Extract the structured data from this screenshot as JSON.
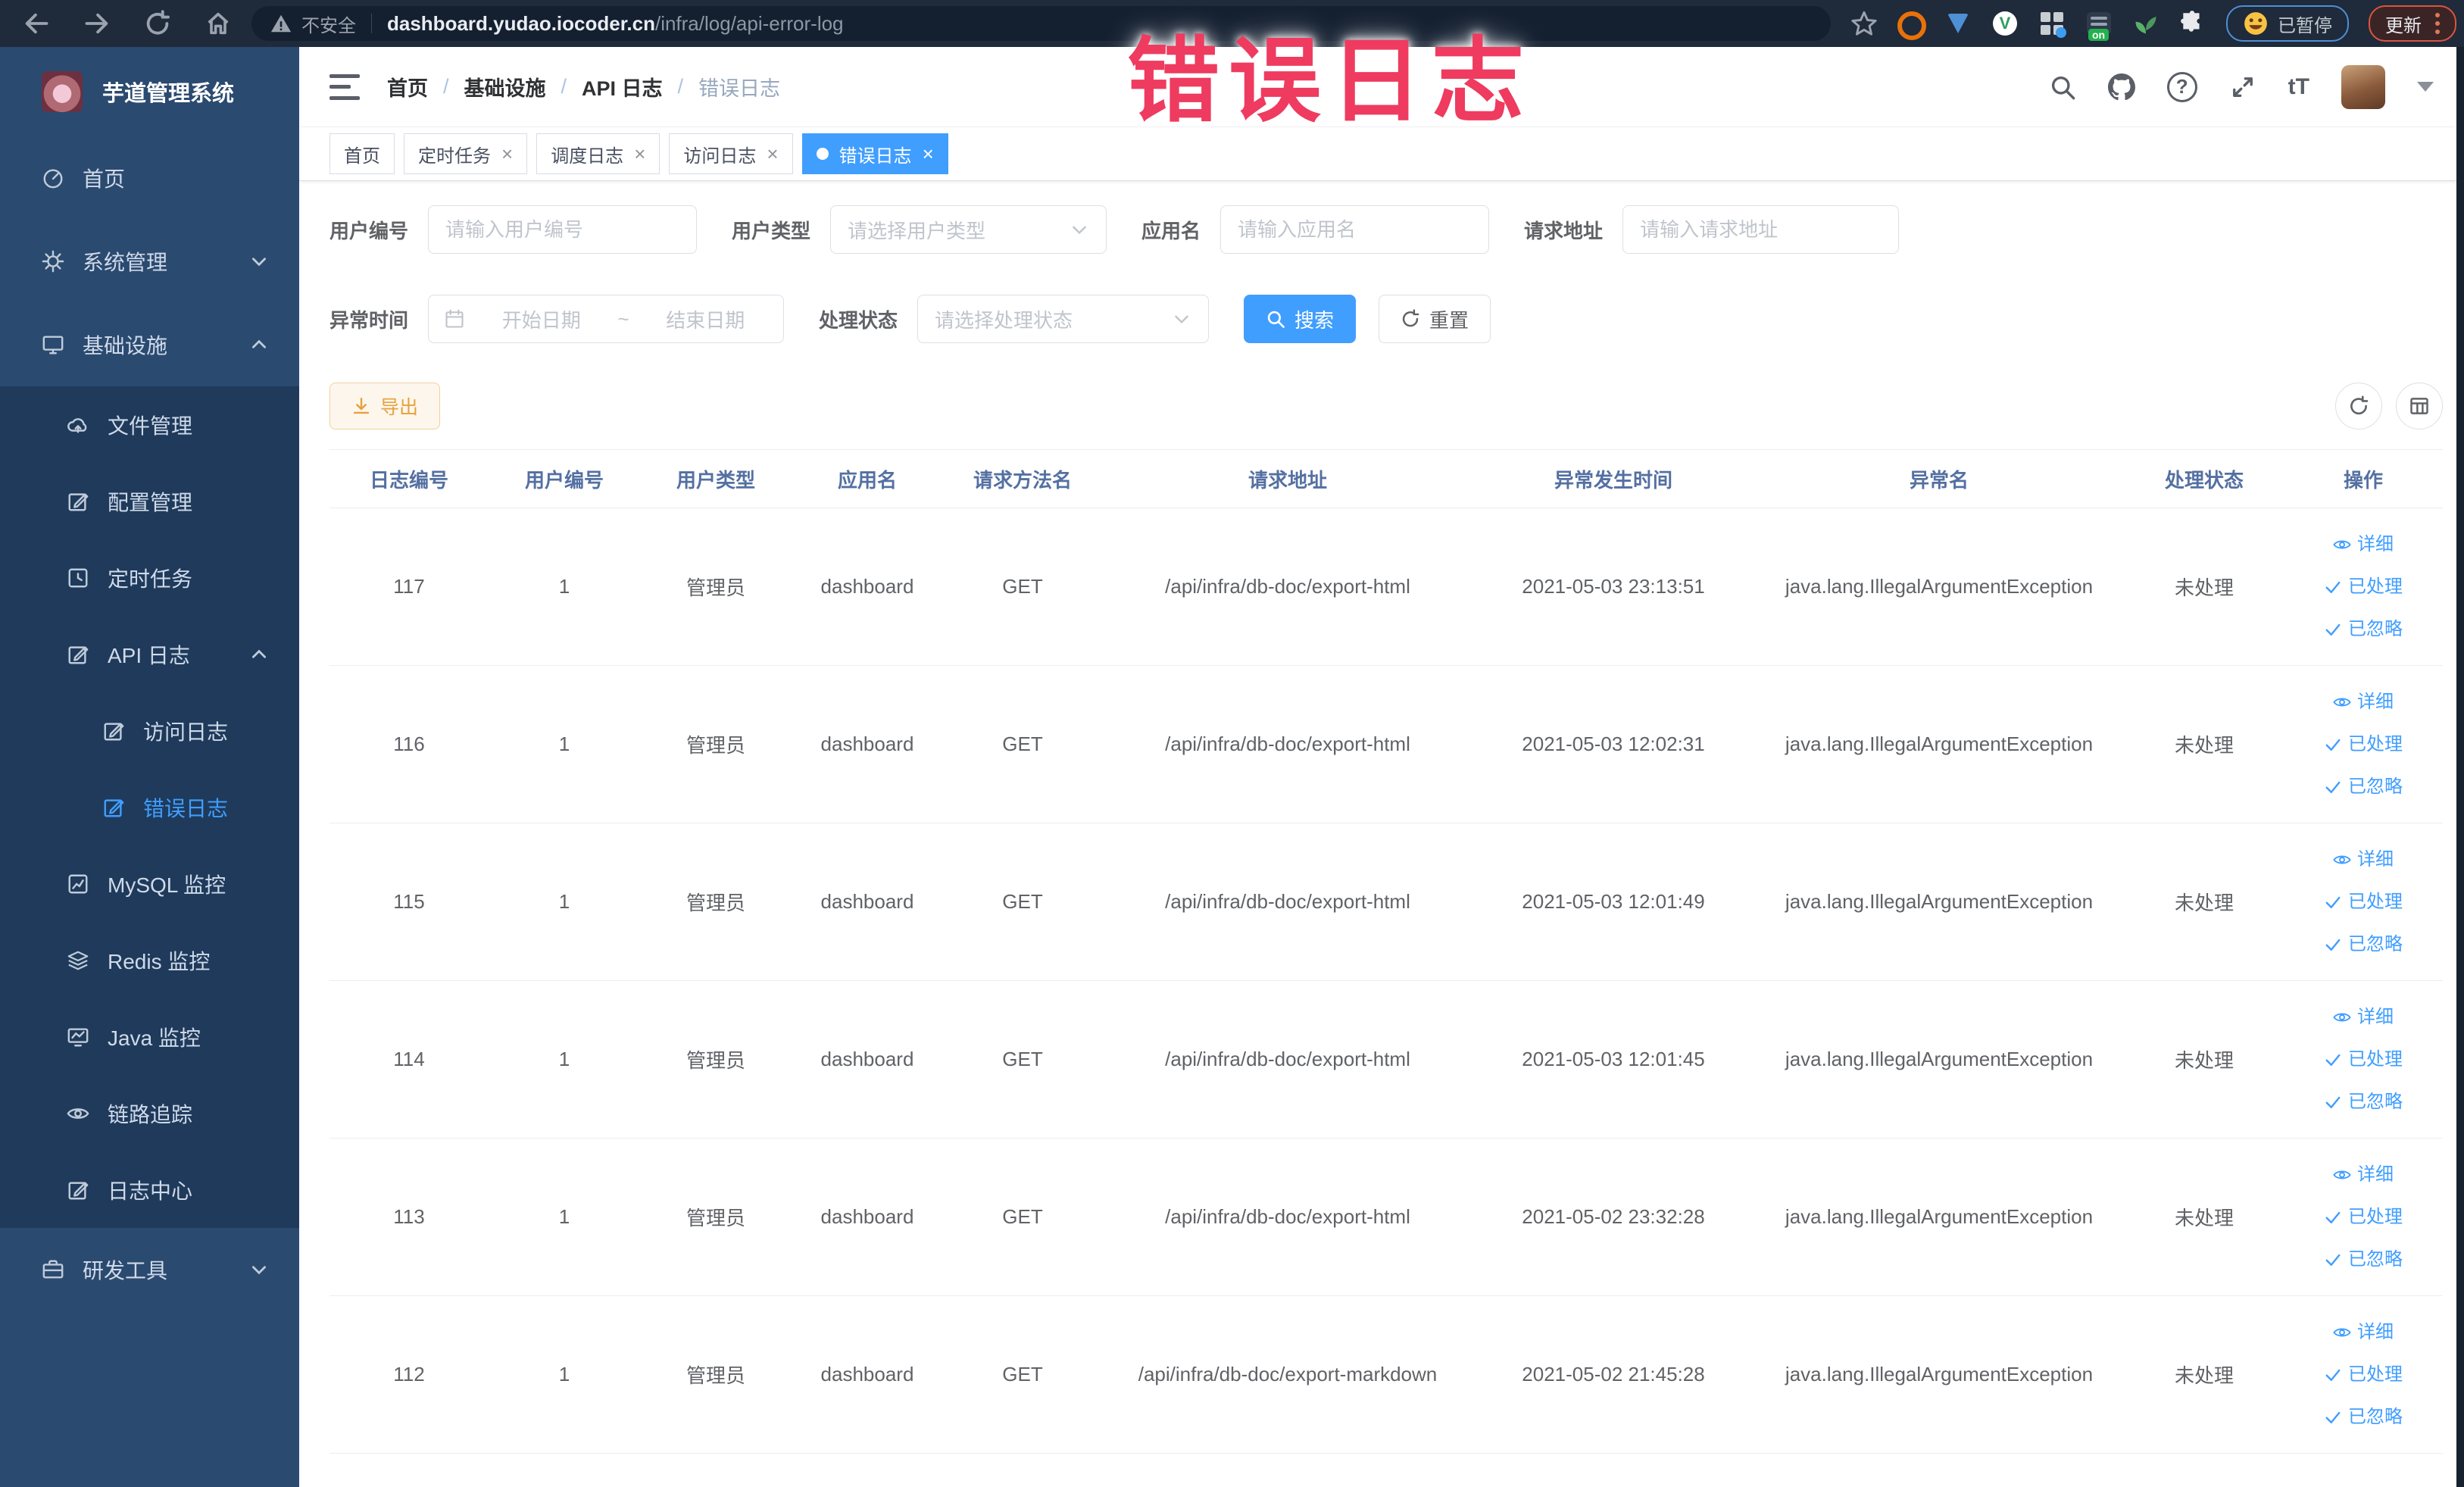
{
  "browser": {
    "security_label": "不安全",
    "url_domain": "dashboard.yudao.iocoder.cn",
    "url_path": "/infra/log/api-error-log",
    "paused_label": "已暂停",
    "update_label": "更新"
  },
  "annotation": {
    "text": "错误日志",
    "color": "#ee3b5f"
  },
  "app": {
    "logo_title": "芋道管理系统"
  },
  "sidebar": {
    "home": "首页",
    "system": "系统管理",
    "infra": "基础设施",
    "file": "文件管理",
    "config": "配置管理",
    "job": "定时任务",
    "api_log": "API 日志",
    "access_log": "访问日志",
    "error_log": "错误日志",
    "mysql": "MySQL 监控",
    "redis": "Redis 监控",
    "java": "Java 监控",
    "tracer": "链路追踪",
    "log_center": "日志中心",
    "dev_tools": "研发工具"
  },
  "breadcrumb": {
    "items": [
      "首页",
      "基础设施",
      "API 日志",
      "错误日志"
    ],
    "separator": "/"
  },
  "tabs": [
    {
      "label": "首页"
    },
    {
      "label": "定时任务"
    },
    {
      "label": "调度日志"
    },
    {
      "label": "访问日志"
    },
    {
      "label": "错误日志"
    }
  ],
  "filters": {
    "user_id_label": "用户编号",
    "user_id_placeholder": "请输入用户编号",
    "user_type_label": "用户类型",
    "user_type_placeholder": "请选择用户类型",
    "app_name_label": "应用名",
    "app_name_placeholder": "请输入应用名",
    "req_url_label": "请求地址",
    "req_url_placeholder": "请输入请求地址",
    "time_label": "异常时间",
    "time_start_placeholder": "开始日期",
    "time_separator": "~",
    "time_end_placeholder": "结束日期",
    "status_label": "处理状态",
    "status_placeholder": "请选择处理状态",
    "search_label": "搜索",
    "reset_label": "重置"
  },
  "actions": {
    "export_label": "导出"
  },
  "table": {
    "columns": [
      "日志编号",
      "用户编号",
      "用户类型",
      "应用名",
      "请求方法名",
      "请求地址",
      "异常发生时间",
      "异常名",
      "处理状态",
      "操作"
    ],
    "op_detail": "详细",
    "op_processed": "已处理",
    "op_ignored": "已忽略",
    "rows": [
      {
        "id": "117",
        "user_id": "1",
        "user_type": "管理员",
        "app": "dashboard",
        "method": "GET",
        "url": "/api/infra/db-doc/export-html",
        "time": "2021-05-03 23:13:51",
        "exception": "java.lang.IllegalArgumentException",
        "status": "未处理"
      },
      {
        "id": "116",
        "user_id": "1",
        "user_type": "管理员",
        "app": "dashboard",
        "method": "GET",
        "url": "/api/infra/db-doc/export-html",
        "time": "2021-05-03 12:02:31",
        "exception": "java.lang.IllegalArgumentException",
        "status": "未处理"
      },
      {
        "id": "115",
        "user_id": "1",
        "user_type": "管理员",
        "app": "dashboard",
        "method": "GET",
        "url": "/api/infra/db-doc/export-html",
        "time": "2021-05-03 12:01:49",
        "exception": "java.lang.IllegalArgumentException",
        "status": "未处理"
      },
      {
        "id": "114",
        "user_id": "1",
        "user_type": "管理员",
        "app": "dashboard",
        "method": "GET",
        "url": "/api/infra/db-doc/export-html",
        "time": "2021-05-03 12:01:45",
        "exception": "java.lang.IllegalArgumentException",
        "status": "未处理"
      },
      {
        "id": "113",
        "user_id": "1",
        "user_type": "管理员",
        "app": "dashboard",
        "method": "GET",
        "url": "/api/infra/db-doc/export-html",
        "time": "2021-05-02 23:32:28",
        "exception": "java.lang.IllegalArgumentException",
        "status": "未处理"
      },
      {
        "id": "112",
        "user_id": "1",
        "user_type": "管理员",
        "app": "dashboard",
        "method": "GET",
        "url": "/api/infra/db-doc/export-markdown",
        "time": "2021-05-02 21:45:28",
        "exception": "java.lang.IllegalArgumentException",
        "status": "未处理"
      }
    ]
  },
  "icons": {
    "close": "×",
    "help": "?",
    "text_size": "tT",
    "on_badge": "on"
  }
}
